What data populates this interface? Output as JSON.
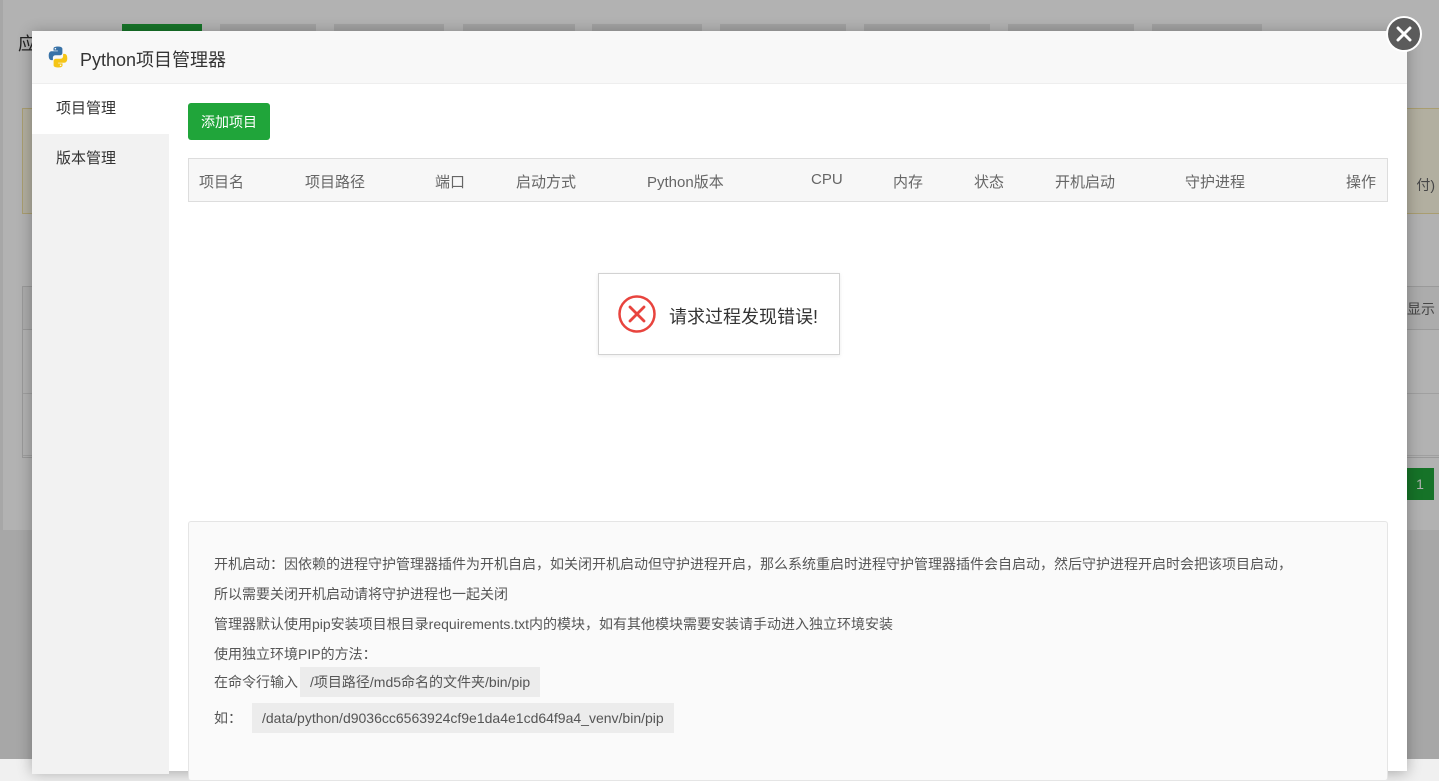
{
  "background": {
    "title_fragment": "应",
    "notice_fragment": "付)",
    "table_head_fragment": "显示",
    "pager_current": "1"
  },
  "modal": {
    "title": "Python项目管理器",
    "logo_icon": "python-logo-icon",
    "close_icon": "close-icon"
  },
  "sidebar": {
    "items": [
      {
        "label": "项目管理",
        "active": true
      },
      {
        "label": "版本管理",
        "active": false
      }
    ]
  },
  "toolbar": {
    "add_label": "添加项目"
  },
  "table": {
    "columns": [
      "项目名",
      "项目路径",
      "端口",
      "启动方式",
      "Python版本",
      "CPU",
      "内存",
      "状态",
      "开机启动",
      "守护进程",
      "操作"
    ]
  },
  "error": {
    "icon": "error-circle-icon",
    "message": "请求过程发现错误!"
  },
  "info": {
    "line1": "开机启动：因依赖的进程守护管理器插件为开机自启，如关闭开机启动但守护进程开启，那么系统重启时进程守护管理器插件会自启动，然后守护进程开启时会把该项目启动，",
    "line2": "所以需要关闭开机启动请将守护进程也一起关闭",
    "line3": "管理器默认使用pip安装项目根目录requirements.txt内的模块，如有其他模块需要安装请手动进入独立环境安装",
    "line4": "使用独立环境PIP的方法：",
    "line5_label": "在命令行输入",
    "line5_code": "/项目路径/md5命名的文件夹/bin/pip",
    "line6_label": "如：",
    "line6_code": "/data/python/d9036cc6563924cf9e1da4e1cd64f9a4_venv/bin/pip"
  },
  "colors": {
    "accent": "#20a53a",
    "error": "#e8443e"
  }
}
